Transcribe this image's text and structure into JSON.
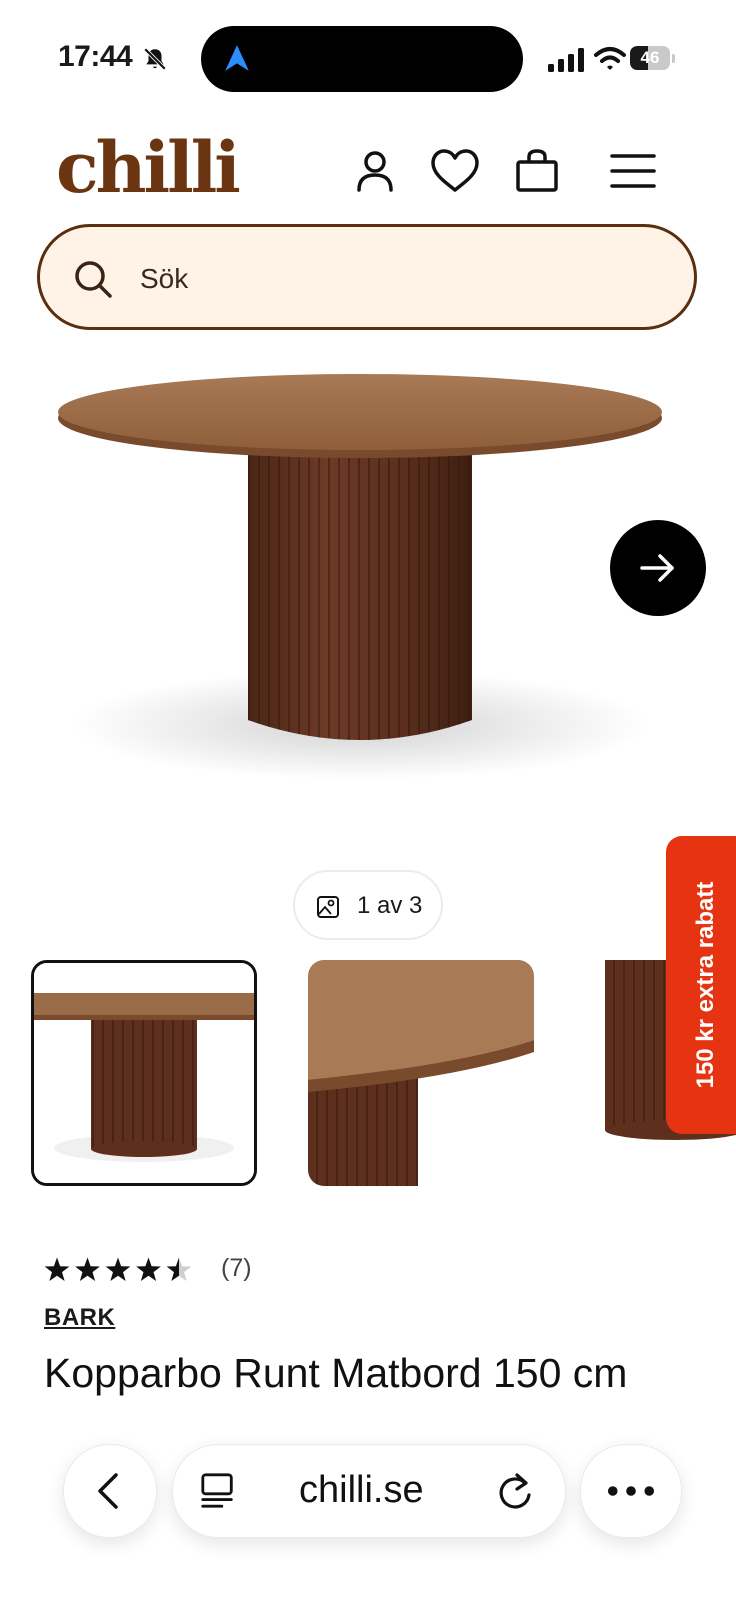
{
  "status_bar": {
    "time": "17:44",
    "battery": "46",
    "battery_level": 0.46
  },
  "header": {
    "logo": "chilli"
  },
  "search": {
    "placeholder": "Sök"
  },
  "gallery": {
    "counter": "1 av 3",
    "current": 1,
    "total": 3
  },
  "promo": {
    "label": "150 kr extra rabatt",
    "color": "#e63312"
  },
  "product": {
    "rating": 4.5,
    "review_count": "(7)",
    "brand": "BARK",
    "title": "Kopparbo Runt Matbord 150 cm"
  },
  "browser": {
    "url": "chilli.se"
  },
  "colors": {
    "brand": "#6b3512",
    "search_bg": "#fff3e8",
    "accent": "#e63312"
  }
}
